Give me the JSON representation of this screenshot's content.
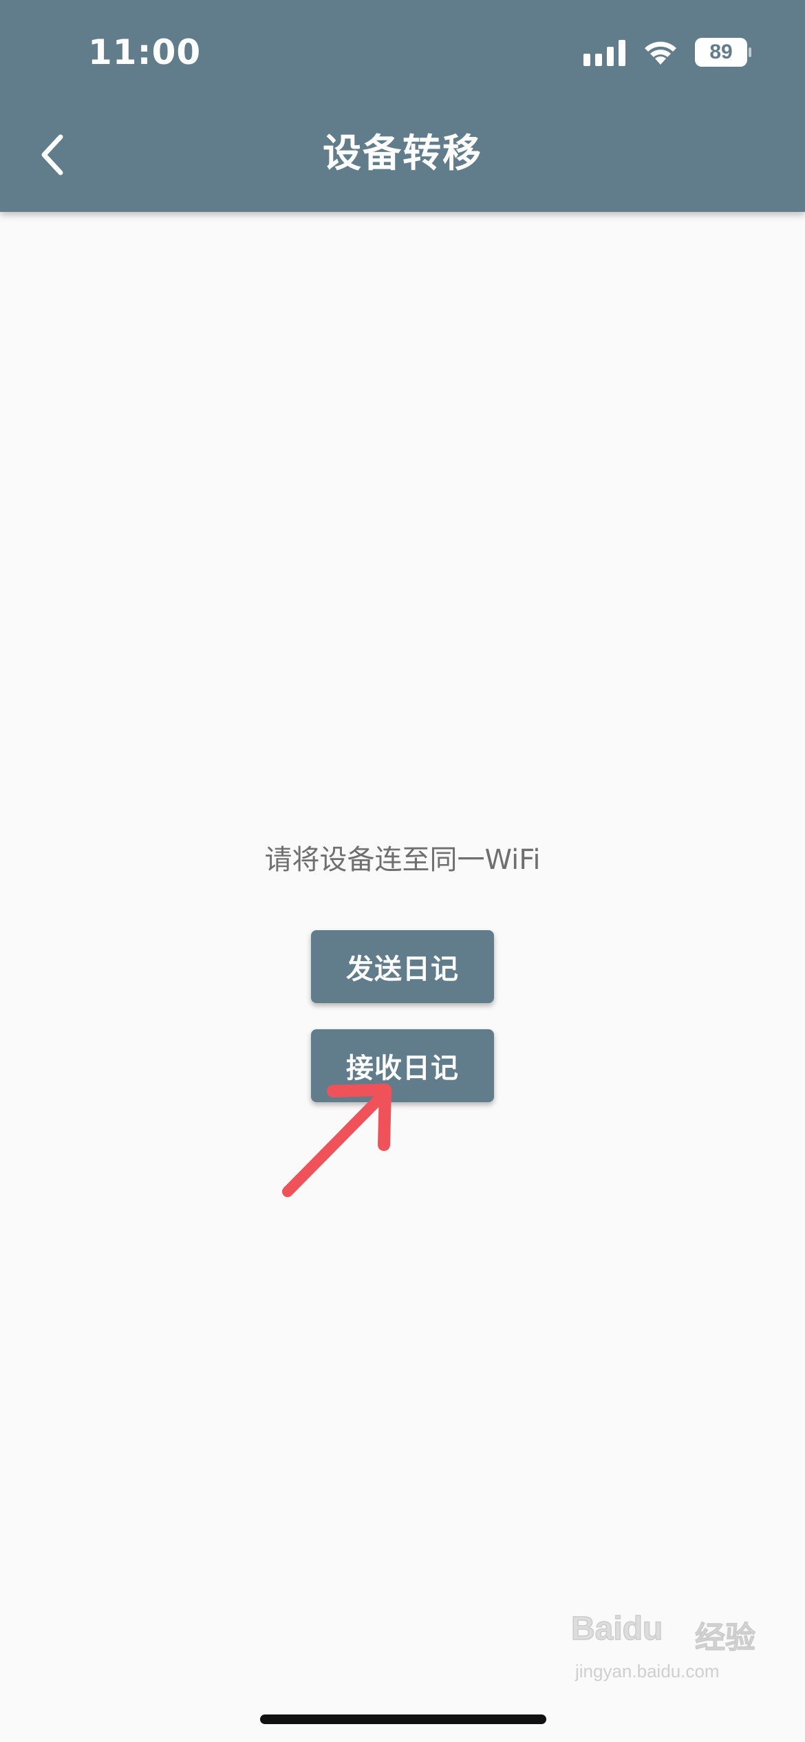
{
  "status_bar": {
    "time": "11:00",
    "battery_level": "89",
    "signal_icon": "cellular-signal-icon",
    "wifi_icon": "wifi-icon"
  },
  "app_bar": {
    "title": "设备转移",
    "back_icon": "chevron-left-icon",
    "background_color": "#617d8b"
  },
  "main": {
    "hint": "请将设备连至同一WiFi",
    "send_button_label": "发送日记",
    "receive_button_label": "接收日记"
  },
  "annotation": {
    "arrow_color": "#f0525a",
    "arrow_icon": "red-arrow-annotation"
  },
  "watermark": {
    "brand": "Baidu",
    "brand_cn": "经验",
    "url": "jingyan.baidu.com"
  }
}
